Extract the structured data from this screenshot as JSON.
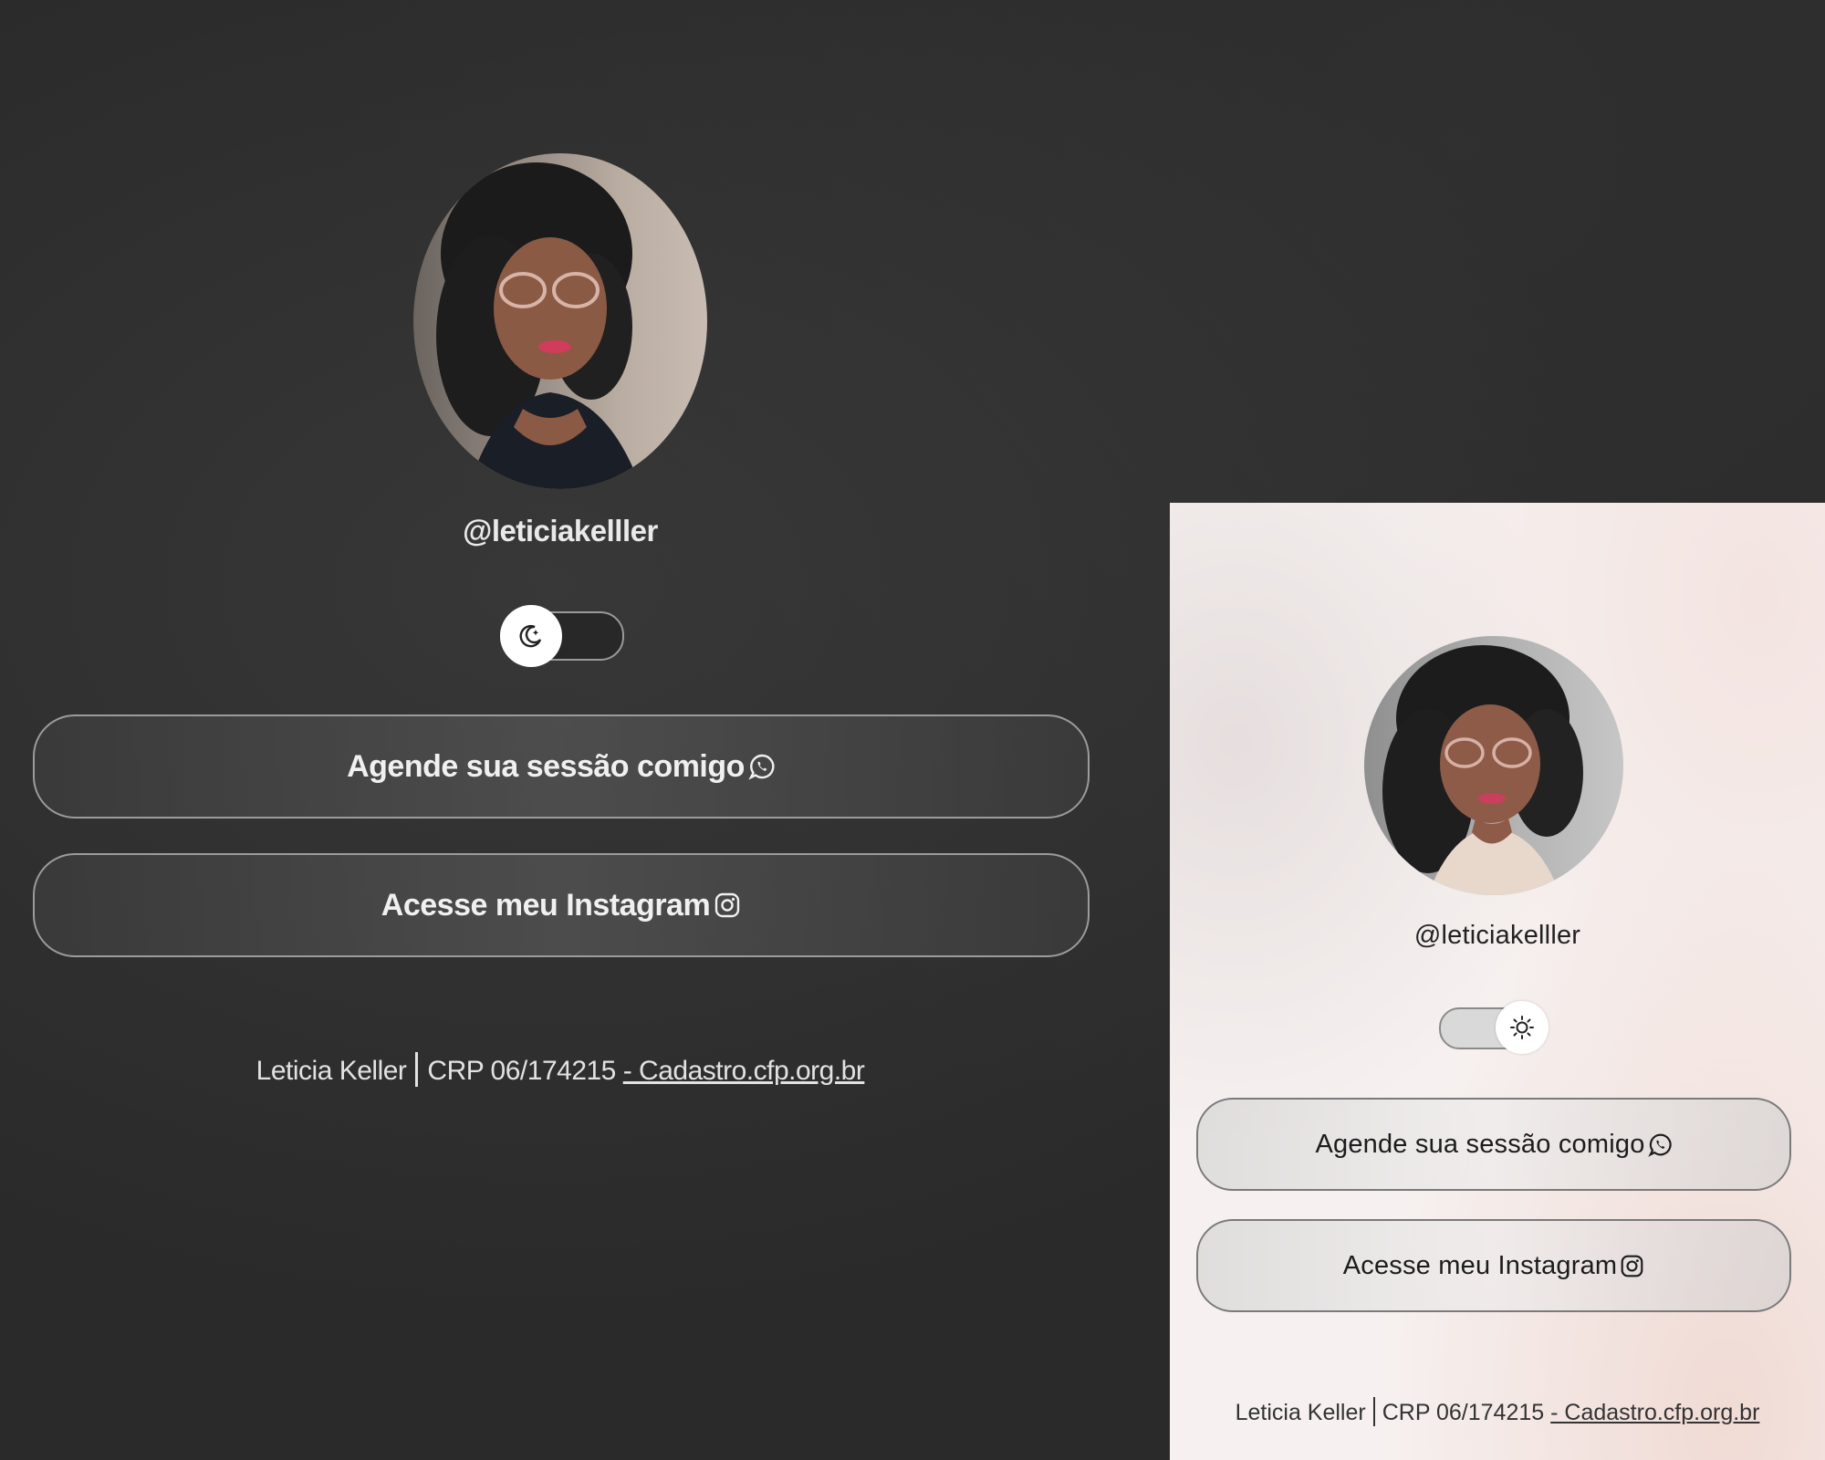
{
  "panels": {
    "dark": {
      "handle": "@leticiakelller",
      "theme_toggle": {
        "state": "dark",
        "icon": "moon-icon"
      },
      "buttons": [
        {
          "label": "Agende sua sessão comigo",
          "icon": "whatsapp-icon"
        },
        {
          "label": "Acesse meu Instagram",
          "icon": "instagram-icon"
        }
      ],
      "footer": {
        "name": "Leticia Keller",
        "crp": "CRP 06/174215",
        "link": "- Cadastro.cfp.org.br"
      }
    },
    "light": {
      "handle": "@leticiakelller",
      "theme_toggle": {
        "state": "light",
        "icon": "sun-icon"
      },
      "buttons": [
        {
          "label": "Agende sua sessão comigo",
          "icon": "whatsapp-icon"
        },
        {
          "label": "Acesse meu Instagram",
          "icon": "instagram-icon"
        }
      ],
      "footer": {
        "name": "Leticia Keller",
        "crp": "CRP 06/174215",
        "link": "- Cadastro.cfp.org.br"
      }
    }
  },
  "colors": {
    "dark_bg": "#2a2a2a",
    "light_bg": "#f6f1f0",
    "text_light": "#f0f0f0",
    "text_dark": "#1c1c1c"
  }
}
